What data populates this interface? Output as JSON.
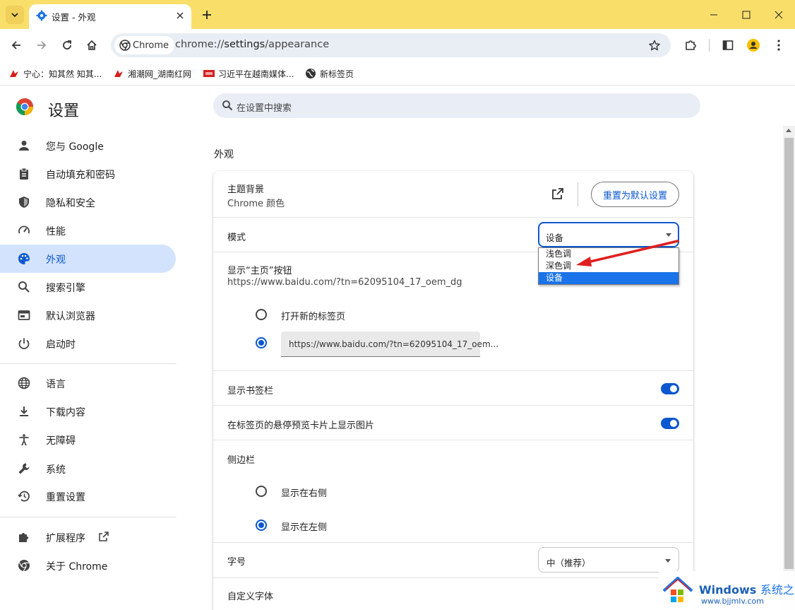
{
  "titlebar": {
    "tab_title": "设置 - 外观",
    "bg_color": "#f9de6a"
  },
  "toolbar": {
    "chip_label": "Chrome",
    "url_scheme": "chrome://",
    "url_host": "settings",
    "url_path": "/appearance"
  },
  "bookmarks": [
    {
      "label": "宁心：知其然 知其...",
      "icon": "toutiao-icon"
    },
    {
      "label": "湘潮网_湖南红网",
      "icon": "toutiao-icon"
    },
    {
      "label": "习近平在越南媒体...",
      "icon": "news-icon"
    },
    {
      "label": "新标签页",
      "icon": "globe-icon"
    }
  ],
  "sidebar": {
    "title": "设置",
    "items": [
      {
        "label": "您与 Google",
        "icon": "person-icon"
      },
      {
        "label": "自动填充和密码",
        "icon": "clipboard-icon"
      },
      {
        "label": "隐私和安全",
        "icon": "shield-icon"
      },
      {
        "label": "性能",
        "icon": "gauge-icon"
      },
      {
        "label": "外观",
        "icon": "palette-icon",
        "active": true
      },
      {
        "label": "搜索引擎",
        "icon": "search-icon"
      },
      {
        "label": "默认浏览器",
        "icon": "browser-icon"
      },
      {
        "label": "启动时",
        "icon": "power-icon"
      },
      {
        "label": "语言",
        "icon": "globe-icon"
      },
      {
        "label": "下载内容",
        "icon": "download-icon"
      },
      {
        "label": "无障碍",
        "icon": "accessibility-icon"
      },
      {
        "label": "系统",
        "icon": "wrench-icon"
      },
      {
        "label": "重置设置",
        "icon": "history-icon"
      },
      {
        "label": "扩展程序",
        "icon": "puzzle-icon"
      },
      {
        "label": "关于 Chrome",
        "icon": "chrome-icon"
      }
    ]
  },
  "search": {
    "placeholder": "在设置中搜索"
  },
  "main": {
    "section_title": "外观",
    "theme": {
      "title": "主题背景",
      "subtitle": "Chrome 颜色",
      "reset_label": "重置为默认设置"
    },
    "mode": {
      "label": "模式",
      "value": "设备",
      "options": [
        "浅色调",
        "深色调",
        "设备"
      ],
      "selected_index": 2
    },
    "home_button": {
      "title": "显示“主页”按钮",
      "subtitle": "https://www.baidu.com/?tn=62095104_17_oem_dg",
      "option_new_tab": "打开新的标签页",
      "custom_url": "https://www.baidu.com/?tn=62095104_17_oem..."
    },
    "bookmarks_bar": {
      "label": "显示书签栏",
      "enabled": true
    },
    "hover_preview": {
      "label": "在标签页的悬停预览卡片上显示图片",
      "enabled": true
    },
    "side_panel": {
      "label": "侧边栏",
      "option_right": "显示在右侧",
      "option_left": "显示在左侧",
      "selected": "left"
    },
    "font_size": {
      "label": "字号",
      "value": "中（推荐）"
    },
    "custom_fonts": {
      "label": "自定义字体"
    }
  },
  "annotation": {
    "color": "#e02020"
  },
  "watermark": {
    "brand": "Windows",
    "brand_suffix": "系统之家",
    "url": "www.bjjmlv.com"
  }
}
